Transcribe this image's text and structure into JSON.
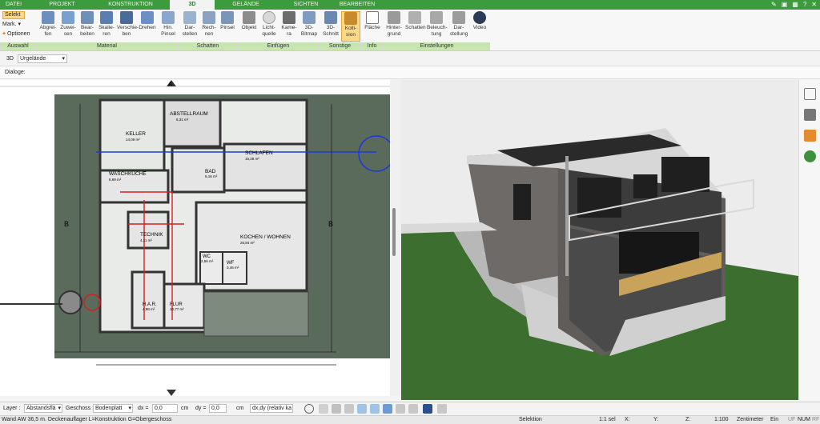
{
  "tabs": [
    "DATEI",
    "PROJEKT",
    "KONSTRUKTION",
    "3D",
    "GELÄNDE",
    "SICHTEN",
    "BEARBEITEN"
  ],
  "selection_panel": {
    "select": "Selekt",
    "mark": "Mark.",
    "options": "Optionen"
  },
  "ribbon_buttons": [
    {
      "l1": "Abgrei-",
      "l2": "fen"
    },
    {
      "l1": "Zuwei-",
      "l2": "sen"
    },
    {
      "l1": "Bear-",
      "l2": "beiten"
    },
    {
      "l1": "Skalie-",
      "l2": "ren"
    },
    {
      "l1": "Verschie-",
      "l2": "ben"
    },
    {
      "l1": "Drehen",
      "l2": ""
    },
    {
      "l1": "Hin.",
      "l2": "Pinsel"
    },
    {
      "l1": "Dar-",
      "l2": "stellen"
    },
    {
      "l1": "Rech-",
      "l2": "nen"
    },
    {
      "l1": "Pinsel",
      "l2": ""
    },
    {
      "l1": "Objekt",
      "l2": ""
    },
    {
      "l1": "Licht-",
      "l2": "quelle"
    },
    {
      "l1": "Kame-",
      "l2": "ra"
    },
    {
      "l1": "3D-",
      "l2": "Bitmap"
    },
    {
      "l1": "3D-",
      "l2": "Schnitt"
    },
    {
      "l1": "Kolli-",
      "l2": "sion"
    },
    {
      "l1": "Fläche",
      "l2": ""
    },
    {
      "l1": "Hinter-",
      "l2": "grund"
    },
    {
      "l1": "Schatten",
      "l2": ""
    },
    {
      "l1": "Beleuch-",
      "l2": "tung"
    },
    {
      "l1": "Dar-",
      "l2": "stellung"
    },
    {
      "l1": "Video",
      "l2": ""
    }
  ],
  "ribbon_groups": [
    "Auswahl",
    "Material",
    "Schatten",
    "Einfügen",
    "Sonstige",
    "Info",
    "Einstellungen"
  ],
  "view_row": {
    "mode": "3D",
    "terrain": "Urgelände"
  },
  "dialog_label": "Dialoge:",
  "plan": {
    "rooms": [
      {
        "name": "KELLER",
        "area": "14,09 m²"
      },
      {
        "name": "ABSTELLRAUM",
        "area": "6,31 m²"
      },
      {
        "name": "SCHLAFEN",
        "area": "15,28 m²"
      },
      {
        "name": "BAD",
        "area": "6,16 m²"
      },
      {
        "name": "WASCHKÜCHE",
        "area": "8,69 m²"
      },
      {
        "name": "TECHNIK",
        "area": "4,11 m²"
      },
      {
        "name": "KOCHEN / WOHNEN",
        "area": "26,84 m²"
      },
      {
        "name": "WC",
        "area": "2,56 m²"
      },
      {
        "name": "WF",
        "area": "3,46 m²"
      },
      {
        "name": "H.A.R.",
        "area": "4,98 m²"
      },
      {
        "name": "FLUR",
        "area": "10,77 m²"
      }
    ],
    "axis_labels": [
      "A",
      "B",
      "B"
    ]
  },
  "bottom_toolbar": {
    "layer_label": "Layer :",
    "layer_value": "Abstandsflä",
    "floor_label": "Geschoss :",
    "floor_value": "Bodenplatt",
    "dx_label": "dx =",
    "dx_value": "0,0",
    "dx_unit": "cm",
    "dy_label": "dy =",
    "dy_value": "0,0",
    "dy_unit": "cm",
    "rel_value": "dx,dy (relativ ka"
  },
  "status_bar": {
    "message": "Wand AW 36,5 m. Deckenauflager L=Konstruktion G=Obergeschoss",
    "mode": "Selektion",
    "selection": "1:1 sel",
    "x_label": "X:",
    "y_label": "Y:",
    "z_label": "Z:",
    "scale": "1:100",
    "unit": "Zentimeter",
    "snap": "Ein",
    "flags": [
      "UF",
      "NUM",
      "RF"
    ]
  },
  "colors": {
    "accent": "#3c9b3c",
    "ribbon_group": "#c7e5ae",
    "active_select": "#fbd98a"
  }
}
